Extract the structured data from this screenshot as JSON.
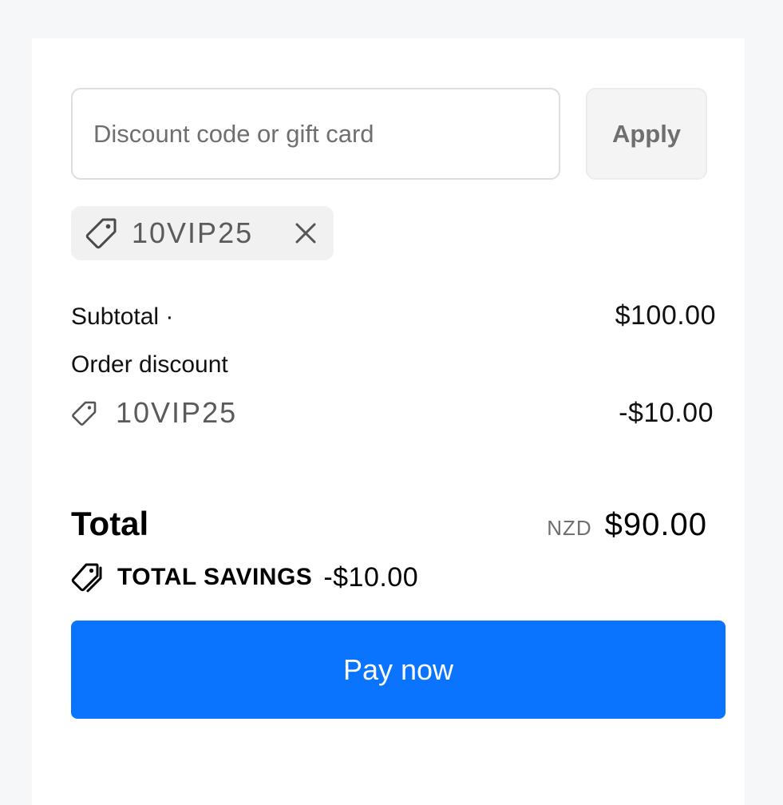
{
  "discount": {
    "placeholder": "Discount code or gift card",
    "apply_label": "Apply",
    "applied_code": "10VIP25"
  },
  "summary": {
    "subtotal_label": "Subtotal ·",
    "subtotal_value": "$100.00",
    "order_discount_label": "Order discount",
    "order_discount_code": "10VIP25",
    "order_discount_value": "-$10.00"
  },
  "total": {
    "label": "Total",
    "currency": "NZD",
    "value": "$90.00",
    "savings_label": "TOTAL SAVINGS",
    "savings_value": "-$10.00"
  },
  "actions": {
    "pay_label": "Pay now"
  },
  "colors": {
    "accent": "#0a74ff",
    "chip_bg": "#f1f1f1",
    "muted_text": "#6f6f6f"
  },
  "icons": {
    "tag": "tag-icon",
    "remove": "close-icon",
    "savings": "tags-icon"
  }
}
